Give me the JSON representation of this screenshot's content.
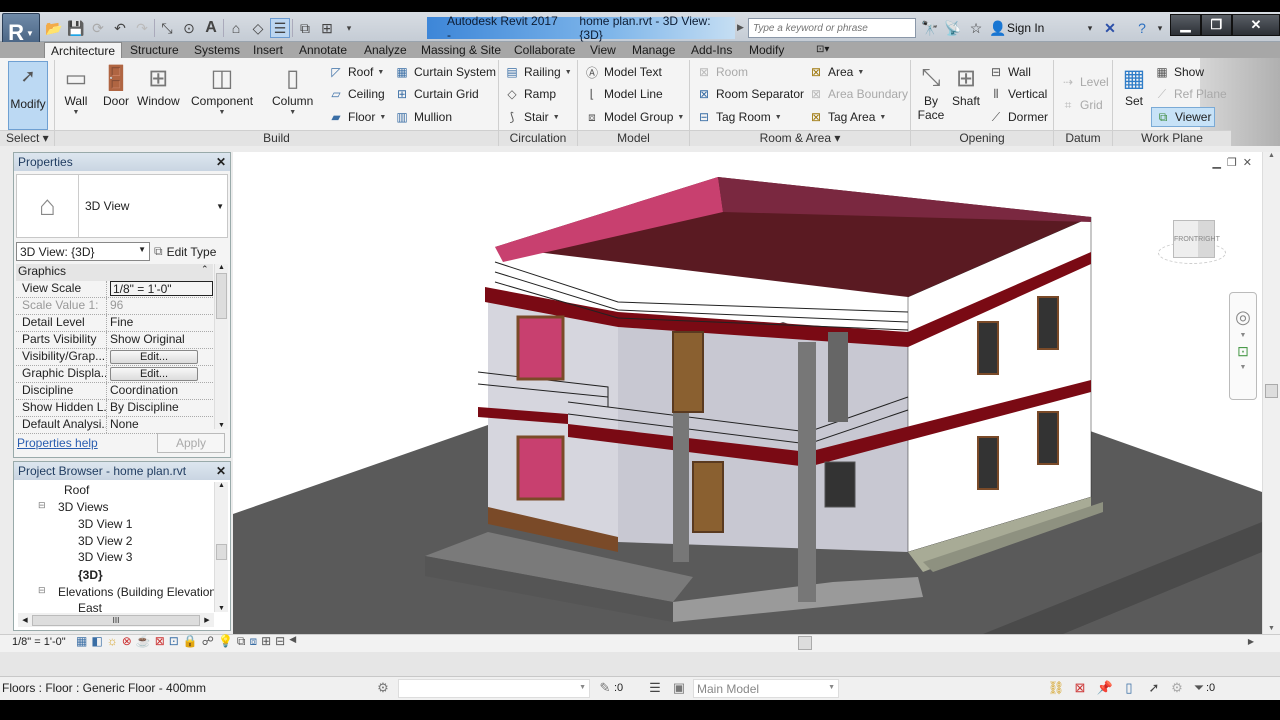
{
  "app": {
    "logo_letter": "R",
    "title_app": "Autodesk Revit 2017 -",
    "title_file": "home plan.rvt - 3D View: {3D}",
    "search_placeholder": "Type a keyword or phrase",
    "sign_in": "Sign In"
  },
  "qat_icons": [
    "open-icon",
    "save-icon",
    "sync-icon",
    "undo-icon",
    "redo-icon",
    "measure-icon",
    "tag-icon",
    "text-icon",
    "3d-view-icon",
    "section-icon",
    "thin-lines-icon",
    "close-hidden-icon",
    "switch-windows-icon",
    "customize-icon"
  ],
  "tabs": [
    "Architecture",
    "Structure",
    "Systems",
    "Insert",
    "Annotate",
    "Analyze",
    "Massing & Site",
    "Collaborate",
    "View",
    "Manage",
    "Add-Ins",
    "Modify"
  ],
  "active_tab": "Architecture",
  "ribbon": {
    "select": {
      "modify": "Modify",
      "label": "Select ▾"
    },
    "build": {
      "label": "Build",
      "big": [
        "Wall",
        "Door",
        "Window",
        "Component",
        "Column"
      ],
      "small_col1": [
        "Roof",
        "Ceiling",
        "Floor"
      ],
      "small_col2": [
        "Curtain System",
        "Curtain Grid",
        "Mullion"
      ]
    },
    "circulation": {
      "label": "Circulation",
      "items": [
        "Railing",
        "Ramp",
        "Stair"
      ]
    },
    "model": {
      "label": "Model",
      "items": [
        "Model Text",
        "Model Line",
        "Model Group"
      ]
    },
    "room_area": {
      "label": "Room & Area ▾",
      "col1": [
        "Room",
        "Room Separator",
        "Tag Room"
      ],
      "col2": [
        "Area",
        "Area Boundary",
        "Tag Area"
      ]
    },
    "opening": {
      "label": "Opening",
      "by_face_1": "By",
      "by_face_2": "Face",
      "shaft": "Shaft",
      "items": [
        "Wall",
        "Vertical",
        "Dormer"
      ]
    },
    "datum": {
      "label": "Datum",
      "items": [
        "Level",
        "Grid"
      ]
    },
    "work_plane": {
      "label": "Work Plane",
      "set": "Set",
      "items": [
        "Show",
        "Ref Plane",
        "Viewer"
      ]
    }
  },
  "properties": {
    "title": "Properties",
    "type_name": "3D View",
    "instance": "3D View: {3D}",
    "edit_type": "Edit Type",
    "group": "Graphics",
    "rows": [
      {
        "k": "View Scale",
        "v": "1/8\" = 1'-0\""
      },
      {
        "k": "Scale Value    1:",
        "v": "96"
      },
      {
        "k": "Detail Level",
        "v": "Fine"
      },
      {
        "k": "Parts Visibility",
        "v": "Show Original"
      },
      {
        "k": "Visibility/Grap...",
        "v": "Edit..."
      },
      {
        "k": "Graphic Displa...",
        "v": "Edit..."
      },
      {
        "k": "Discipline",
        "v": "Coordination"
      },
      {
        "k": "Show Hidden L...",
        "v": "By Discipline"
      },
      {
        "k": "Default Analysi...",
        "v": "None"
      }
    ],
    "help": "Properties help",
    "apply": "Apply"
  },
  "browser": {
    "title": "Project Browser - home plan.rvt",
    "items": [
      {
        "label": "Roof",
        "level": 2
      },
      {
        "label": "3D Views",
        "level": 1
      },
      {
        "label": "3D View 1",
        "level": 2
      },
      {
        "label": "3D View 2",
        "level": 2
      },
      {
        "label": "3D View 3",
        "level": 2,
        "selected": true
      },
      {
        "label": "{3D}",
        "level": 2,
        "bold": true
      },
      {
        "label": "Elevations (Building Elevation)",
        "level": 1
      },
      {
        "label": "East",
        "level": 2
      }
    ],
    "hscroll_grip": "III"
  },
  "viewcube": {
    "front": "FRONT",
    "right": "RIGHT"
  },
  "viewbar": {
    "scale": "1/8\" = 1'-0\""
  },
  "status": {
    "message": "Floors : Floor : Generic Floor - 400mm",
    "worksets_count": ":0",
    "design_option": "Main Model",
    "filter_count": ":0"
  },
  "colors": {
    "accent": "#3d86d8",
    "roof_pink": "#c8406f",
    "band_red": "#7a0a14",
    "ground": "#5a5a5a"
  }
}
